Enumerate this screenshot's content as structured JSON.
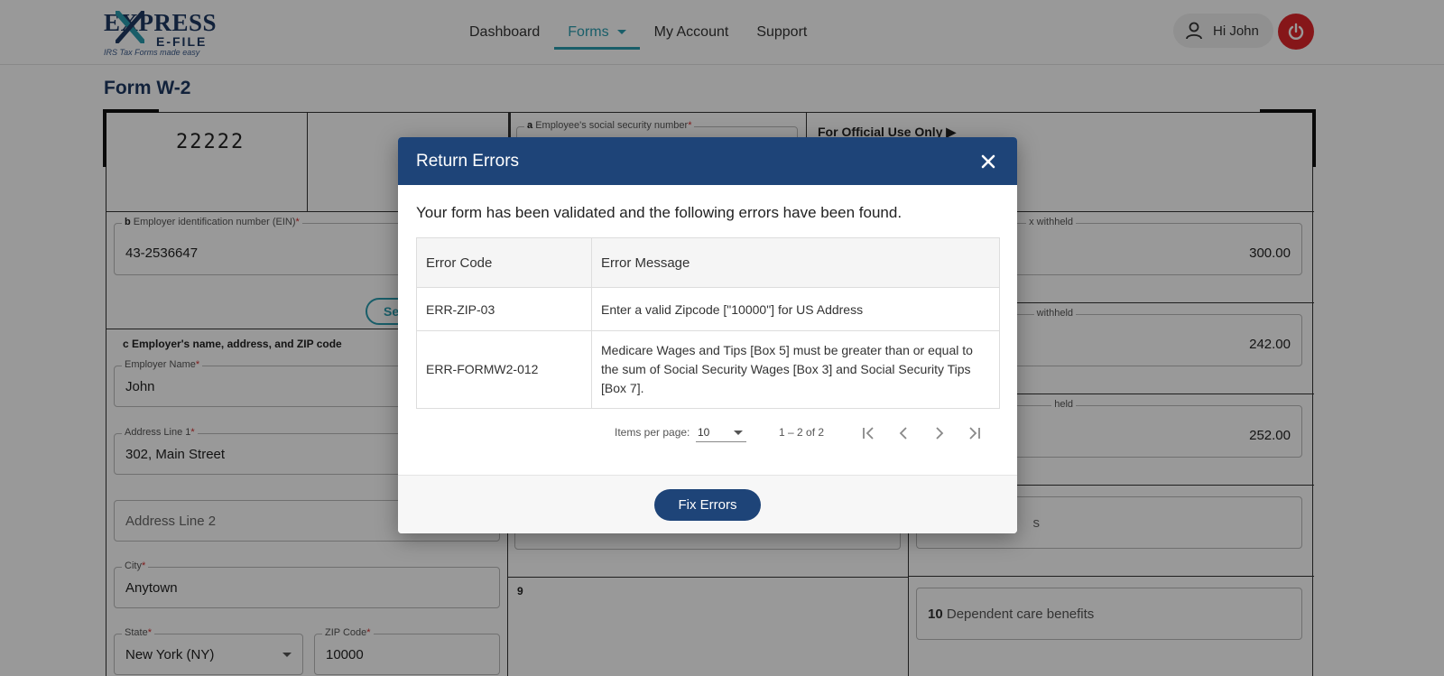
{
  "header": {
    "logo": {
      "express": "EXPRESS",
      "efile": "E-FILE",
      "tagline": "IRS Tax Forms made easy"
    },
    "nav": [
      {
        "label": "Dashboard"
      },
      {
        "label": "Forms"
      },
      {
        "label": "My Account"
      },
      {
        "label": "Support"
      }
    ],
    "user_greeting": "Hi John"
  },
  "page": {
    "title": "Form W-2"
  },
  "form": {
    "control_code": "22222",
    "ssn_label_prefix": "a",
    "ssn_label": "Employee's social security number",
    "official_use": "For Official Use Only ▶",
    "ein_label_prefix": "b",
    "ein_label": "Employer identification number (EIN)",
    "ein_value": "43-2536647",
    "search_button_partial": "Se",
    "employer_section": "c Employer's name, address, and ZIP code",
    "employer_name_label": "Employer Name",
    "employer_name_value": "John",
    "address1_label": "Address Line 1",
    "address1_value": "302, Main Street",
    "address2_placeholder": "Address Line 2",
    "city_label": "City",
    "city_value": "Anytown",
    "state_label": "State",
    "state_value": "New York (NY)",
    "zip_label": "ZIP Code",
    "zip_value": "10000",
    "box2_label_partial": "x withheld",
    "box2_value": "300.00",
    "box4_label_partial": "withheld",
    "box4_value": "242.00",
    "box6_label_partial": "held",
    "box6_value": "252.00",
    "box8_partial": "s",
    "box9_label": "9",
    "box10_label_num": "10",
    "box10_label": "Dependent care benefits"
  },
  "modal": {
    "title": "Return Errors",
    "intro": "Your form has been validated and the following errors have been found.",
    "columns": [
      "Error Code",
      "Error Message"
    ],
    "rows": [
      {
        "code": "ERR-ZIP-03",
        "message": "Enter a valid Zipcode [\"10000\"] for US Address"
      },
      {
        "code": "ERR-FORMW2-012",
        "message": "Medicare Wages and Tips [Box 5] must be greater than or equal to the sum of Social Security Wages [Box 3] and Social Security Tips [Box 7]."
      }
    ],
    "paginator": {
      "items_per_page_label": "Items per page:",
      "items_per_page_value": "10",
      "range": "1 – 2 of 2"
    },
    "fix_button": "Fix Errors"
  },
  "colors": {
    "brand_navy": "#1e4478",
    "nav_active": "#2a9db0",
    "power_red": "#e0262b"
  },
  "icons": {
    "close": "close-icon",
    "user": "user-icon",
    "power": "power-icon",
    "first_page": "first-page-icon",
    "prev_page": "chevron-left-icon",
    "next_page": "chevron-right-icon",
    "last_page": "last-page-icon"
  }
}
